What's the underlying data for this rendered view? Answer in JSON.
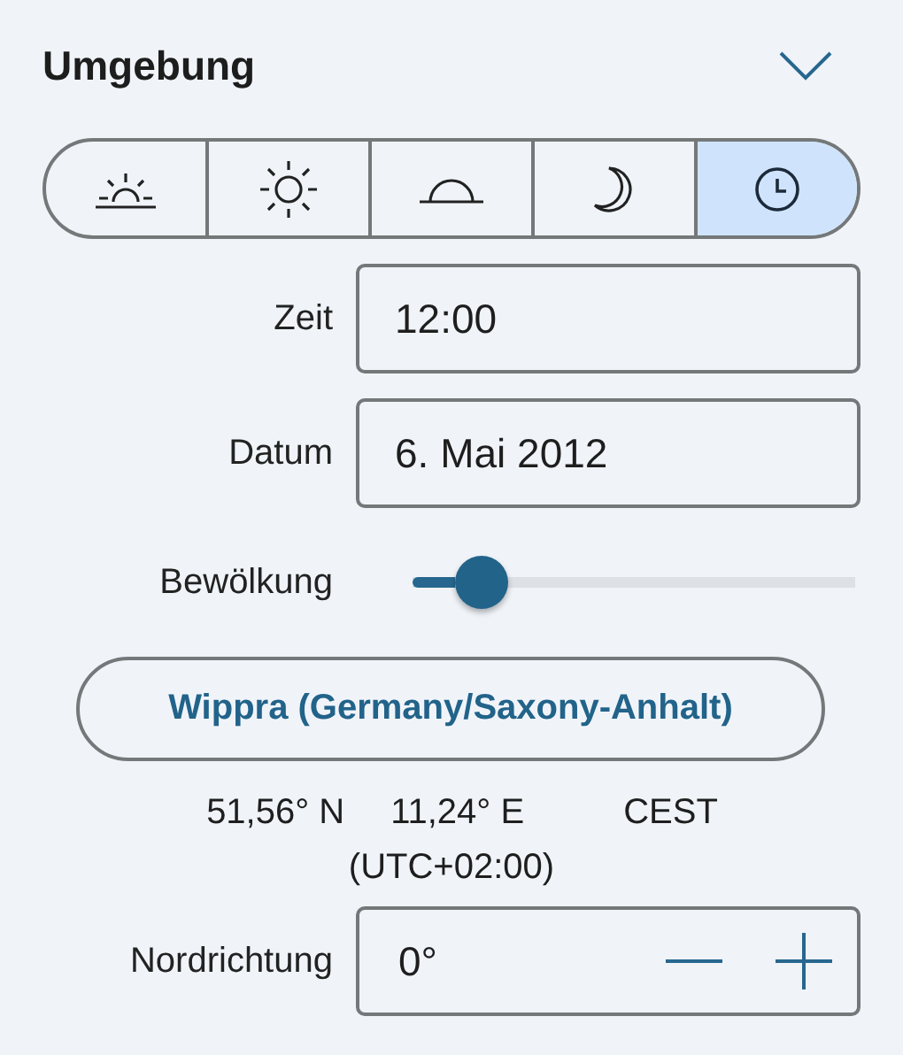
{
  "section": {
    "title": "Umgebung",
    "expanded": true
  },
  "time_modes": [
    {
      "kind": "sunrise",
      "selected": false
    },
    {
      "kind": "sun",
      "selected": false
    },
    {
      "kind": "sunset",
      "selected": false
    },
    {
      "kind": "moon",
      "selected": false
    },
    {
      "kind": "clock",
      "selected": true
    }
  ],
  "time": {
    "label": "Zeit",
    "value": "12:00"
  },
  "date": {
    "label": "Datum",
    "value": "6. Mai 2012"
  },
  "cloudiness": {
    "label": "Bewölkung",
    "level": 0.11
  },
  "location": {
    "name": "Wippra (Germany/Saxony-Anhalt)",
    "latitude": "51,56° N",
    "longitude": "11,24° E",
    "timezone": "CEST",
    "utc_offset": "(UTC+02:00)"
  },
  "north": {
    "label": "Nordrichtung",
    "value": "0°"
  }
}
